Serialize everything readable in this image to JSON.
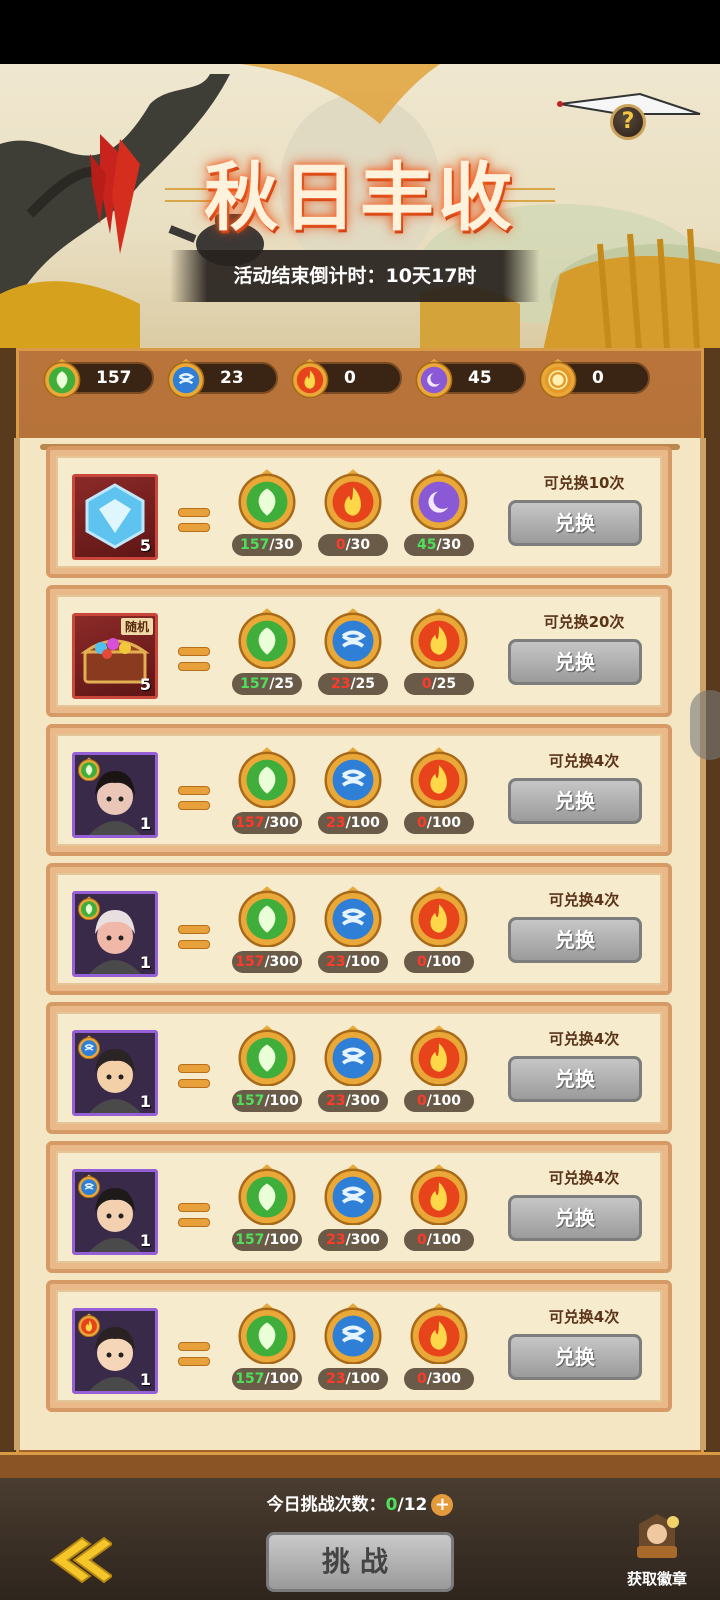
{
  "event": {
    "title": "秋日丰收",
    "countdown": "活动结束倒计时：10天17时"
  },
  "currencies": [
    {
      "icon": "leaf-token-icon",
      "color": "green",
      "value": "157"
    },
    {
      "icon": "water-token-icon",
      "color": "blue",
      "value": "23"
    },
    {
      "icon": "fire-token-icon",
      "color": "red",
      "value": "0"
    },
    {
      "icon": "moon-token-icon",
      "color": "purple",
      "value": "45"
    },
    {
      "icon": "sun-token-icon",
      "color": "gold",
      "value": "0"
    }
  ],
  "exchange_rows": [
    {
      "reward": "blue-gem-icon",
      "reward_count": "5",
      "limit": "可兑换10次",
      "button": "兑换",
      "costs": [
        {
          "type": "leaf",
          "have": "157",
          "need": "/30",
          "ok": true
        },
        {
          "type": "fire",
          "have": "0",
          "need": "/30",
          "ok": false
        },
        {
          "type": "moon",
          "have": "45",
          "need": "/30",
          "ok": true
        }
      ]
    },
    {
      "reward": "treasure-chest-icon",
      "reward_count": "5",
      "tag": "随机",
      "limit": "可兑换20次",
      "button": "兑换",
      "costs": [
        {
          "type": "leaf",
          "have": "157",
          "need": "/25",
          "ok": true
        },
        {
          "type": "water",
          "have": "23",
          "need": "/25",
          "ok": false
        },
        {
          "type": "fire",
          "have": "0",
          "need": "/25",
          "ok": false
        }
      ]
    },
    {
      "reward": "hero-portrait-1",
      "reward_count": "1",
      "badge": "leaf",
      "limit": "可兑换4次",
      "button": "兑换",
      "costs": [
        {
          "type": "leaf",
          "have": "157",
          "need": "/300",
          "ok": false
        },
        {
          "type": "water",
          "have": "23",
          "need": "/100",
          "ok": false
        },
        {
          "type": "fire",
          "have": "0",
          "need": "/100",
          "ok": false
        }
      ]
    },
    {
      "reward": "hero-portrait-2",
      "reward_count": "1",
      "badge": "leaf",
      "limit": "可兑换4次",
      "button": "兑换",
      "costs": [
        {
          "type": "leaf",
          "have": "157",
          "need": "/300",
          "ok": false
        },
        {
          "type": "water",
          "have": "23",
          "need": "/100",
          "ok": false
        },
        {
          "type": "fire",
          "have": "0",
          "need": "/100",
          "ok": false
        }
      ]
    },
    {
      "reward": "hero-portrait-3",
      "reward_count": "1",
      "badge": "water",
      "limit": "可兑换4次",
      "button": "兑换",
      "costs": [
        {
          "type": "leaf",
          "have": "157",
          "need": "/100",
          "ok": true
        },
        {
          "type": "water",
          "have": "23",
          "need": "/300",
          "ok": false
        },
        {
          "type": "fire",
          "have": "0",
          "need": "/100",
          "ok": false
        }
      ]
    },
    {
      "reward": "hero-portrait-4",
      "reward_count": "1",
      "badge": "water",
      "limit": "可兑换4次",
      "button": "兑换",
      "costs": [
        {
          "type": "leaf",
          "have": "157",
          "need": "/100",
          "ok": true
        },
        {
          "type": "water",
          "have": "23",
          "need": "/300",
          "ok": false
        },
        {
          "type": "fire",
          "have": "0",
          "need": "/100",
          "ok": false
        }
      ]
    },
    {
      "reward": "hero-portrait-5",
      "reward_count": "1",
      "badge": "fire",
      "limit": "可兑换4次",
      "button": "兑换",
      "costs": [
        {
          "type": "leaf",
          "have": "157",
          "need": "/100",
          "ok": true
        },
        {
          "type": "water",
          "have": "23",
          "need": "/100",
          "ok": false
        },
        {
          "type": "fire",
          "have": "0",
          "need": "/300",
          "ok": false
        }
      ]
    }
  ],
  "footer": {
    "challenge_label": "今日挑战次数：",
    "challenge_used": "0",
    "challenge_total": "/12",
    "plus": "+",
    "challenge_button": "挑战",
    "badge_link": "获取徽章"
  },
  "colors": {
    "leaf": "#3fae3a",
    "water": "#2f7fd6",
    "fire": "#e8441c",
    "moon": "#8a5ad6",
    "sun": "#e39a2a",
    "ok_text": "#4ee05a",
    "bad_text": "#ff3a2a"
  }
}
